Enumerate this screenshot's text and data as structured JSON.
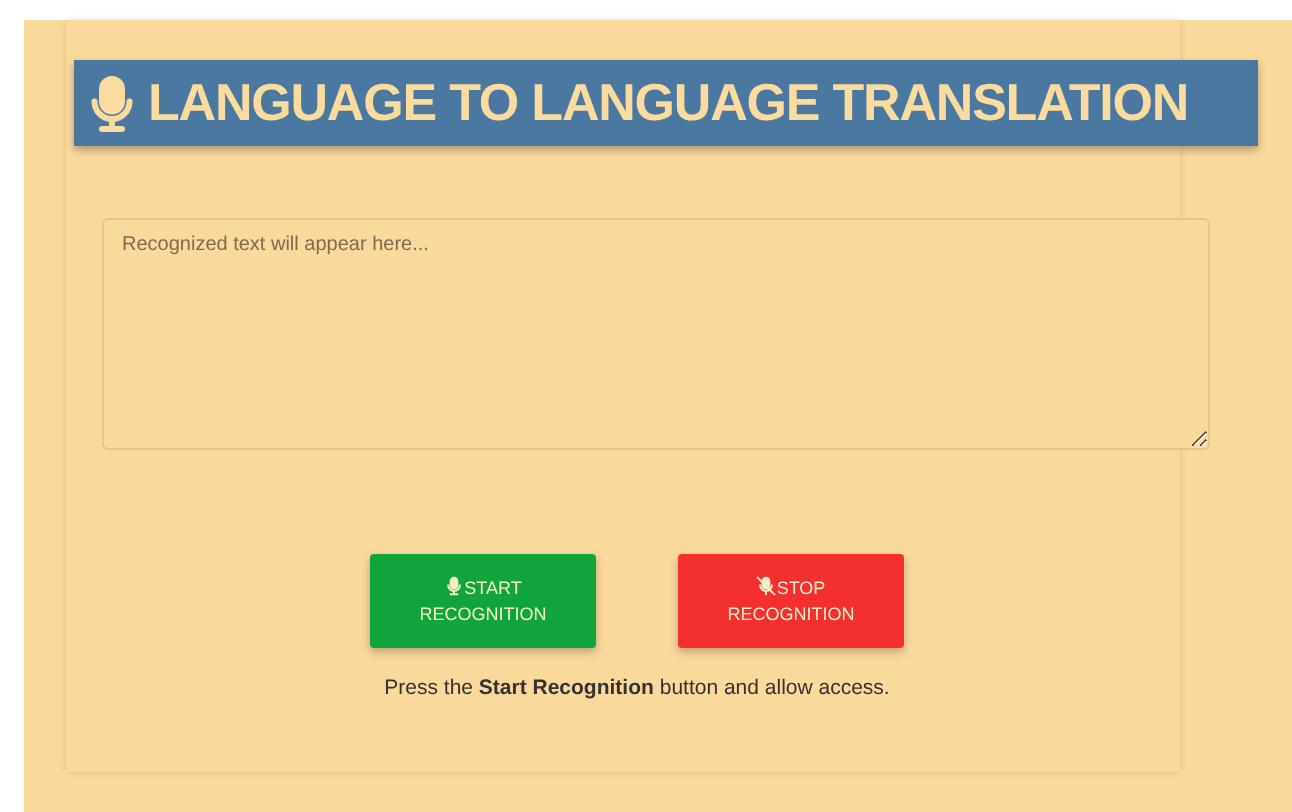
{
  "title": "LANGUAGE TO LANGUAGE TRANSLATION",
  "transcript": {
    "placeholder": "Recognized text will appear here..."
  },
  "buttons": [
    {
      "kind": "start",
      "label": "START RECOGNITION"
    },
    {
      "kind": "stop",
      "label": "STOP RECOGNITION"
    }
  ],
  "hint": "Press the **Start Recognition** button and allow access."
}
